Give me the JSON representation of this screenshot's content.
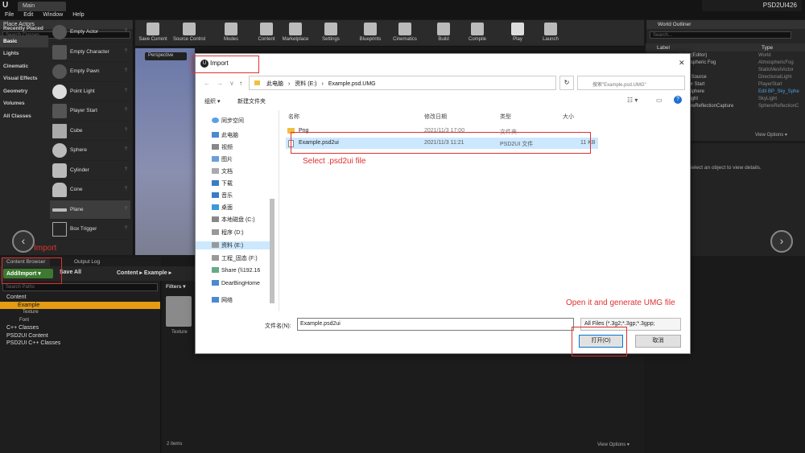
{
  "window": {
    "doc_tab": "Main",
    "project_name": "PSD2UI426",
    "controls": "—  ▢  ✕"
  },
  "menu": [
    "File",
    "Edit",
    "Window",
    "Help"
  ],
  "place_actors": {
    "title": "Place Actors",
    "search_placeholder": "Search Classes",
    "categories": [
      "Recently Placed",
      "Basic",
      "Lights",
      "Cinematic",
      "Visual Effects",
      "Geometry",
      "Volumes",
      "All Classes"
    ],
    "actors": [
      "Empty Actor",
      "Empty Character",
      "Empty Pawn",
      "Point Light",
      "Player Start",
      "Cube",
      "Sphere",
      "Cylinder",
      "Cone",
      "Plane",
      "Box Trigger"
    ]
  },
  "toolbar": [
    "Save Current",
    "Source Control",
    "Modes",
    "Content",
    "Marketplace",
    "Settings",
    "Blueprints",
    "Cinematics",
    "Build",
    "Compile",
    "Play",
    "Launch"
  ],
  "viewport": {
    "perspective": "Perspective"
  },
  "content_browser": {
    "tabs": [
      "Content Browser",
      "Output Log"
    ],
    "add_import": "Add/Import ▾",
    "save_all": "Save All",
    "breadcrumb": "Content  ▸  Example  ▸",
    "paths_search": "Search Paths",
    "filters": "Filters ▾",
    "tree": [
      "Content",
      "Example",
      "Texture",
      "Font",
      "C++ Classes",
      "PSD2UI Content",
      "PSD2UI C++ Classes"
    ],
    "folder_label": "Texture",
    "item_count": "2 items",
    "view_options": "View Options ▾"
  },
  "world_outliner": {
    "title": "World Outliner",
    "search_placeholder": "Search...",
    "col_label": "Label",
    "col_type": "Type",
    "rows": [
      {
        "name": "Main (Editor)",
        "type": "World"
      },
      {
        "name": "Atmospheric Fog",
        "type": "AtmosphericFog"
      },
      {
        "name": "",
        "type": "StaticMeshActor"
      },
      {
        "name": "Light Source",
        "type": "DirectionalLight"
      },
      {
        "name": "Player Start",
        "type": "PlayerStart"
      },
      {
        "name": "Sky Sphere",
        "type": "Edit BP_Sky_Sphe"
      },
      {
        "name": "SkyLight",
        "type": "SkyLight"
      },
      {
        "name": "SphereReflectionCapture",
        "type": "SphereReflectionC"
      }
    ],
    "view_options": "View Options ▾",
    "details_msg": "Select an object to view details."
  },
  "dialog": {
    "title": "Import",
    "address": [
      "此电脑",
      "›",
      "资料 (E:)",
      "›",
      "Example.psd.UMG"
    ],
    "search_placeholder": "搜索\"Example.psd.UMG\"",
    "organize": "组织 ▾",
    "new_folder": "新建文件夹",
    "nav": [
      "同步空间",
      "此电脑",
      "视频",
      "图片",
      "文档",
      "下载",
      "音乐",
      "桌面",
      "本地磁盘 (C:)",
      "程序 (D:)",
      "资料 (E:)",
      "工程_固态 (F:)",
      "Share (\\\\192.16",
      "DearBingHome",
      "网络"
    ],
    "columns": [
      "名称",
      "修改日期",
      "类型",
      "大小"
    ],
    "files": [
      {
        "name": "Png",
        "date": "2021/11/3 17:00",
        "type": "文件夹",
        "size": ""
      },
      {
        "name": "Example.psd2ui",
        "date": "2021/11/3 11:21",
        "type": "PSD2UI 文件",
        "size": "11 KB"
      }
    ],
    "filename_label": "文件名(N):",
    "filename_value": "Example.psd2ui",
    "filetype": "All Files (*.3g2;*.3gp;*.3gpp;",
    "open": "打开(O)",
    "cancel": "取消"
  },
  "annotations": {
    "import": "Import",
    "select": "Select .psd2ui file",
    "open": "Open it and generate UMG file"
  },
  "colors": {
    "annotation": "#e03030",
    "selected_folder": "#e59b12",
    "add_import": "#3d7a2f"
  }
}
